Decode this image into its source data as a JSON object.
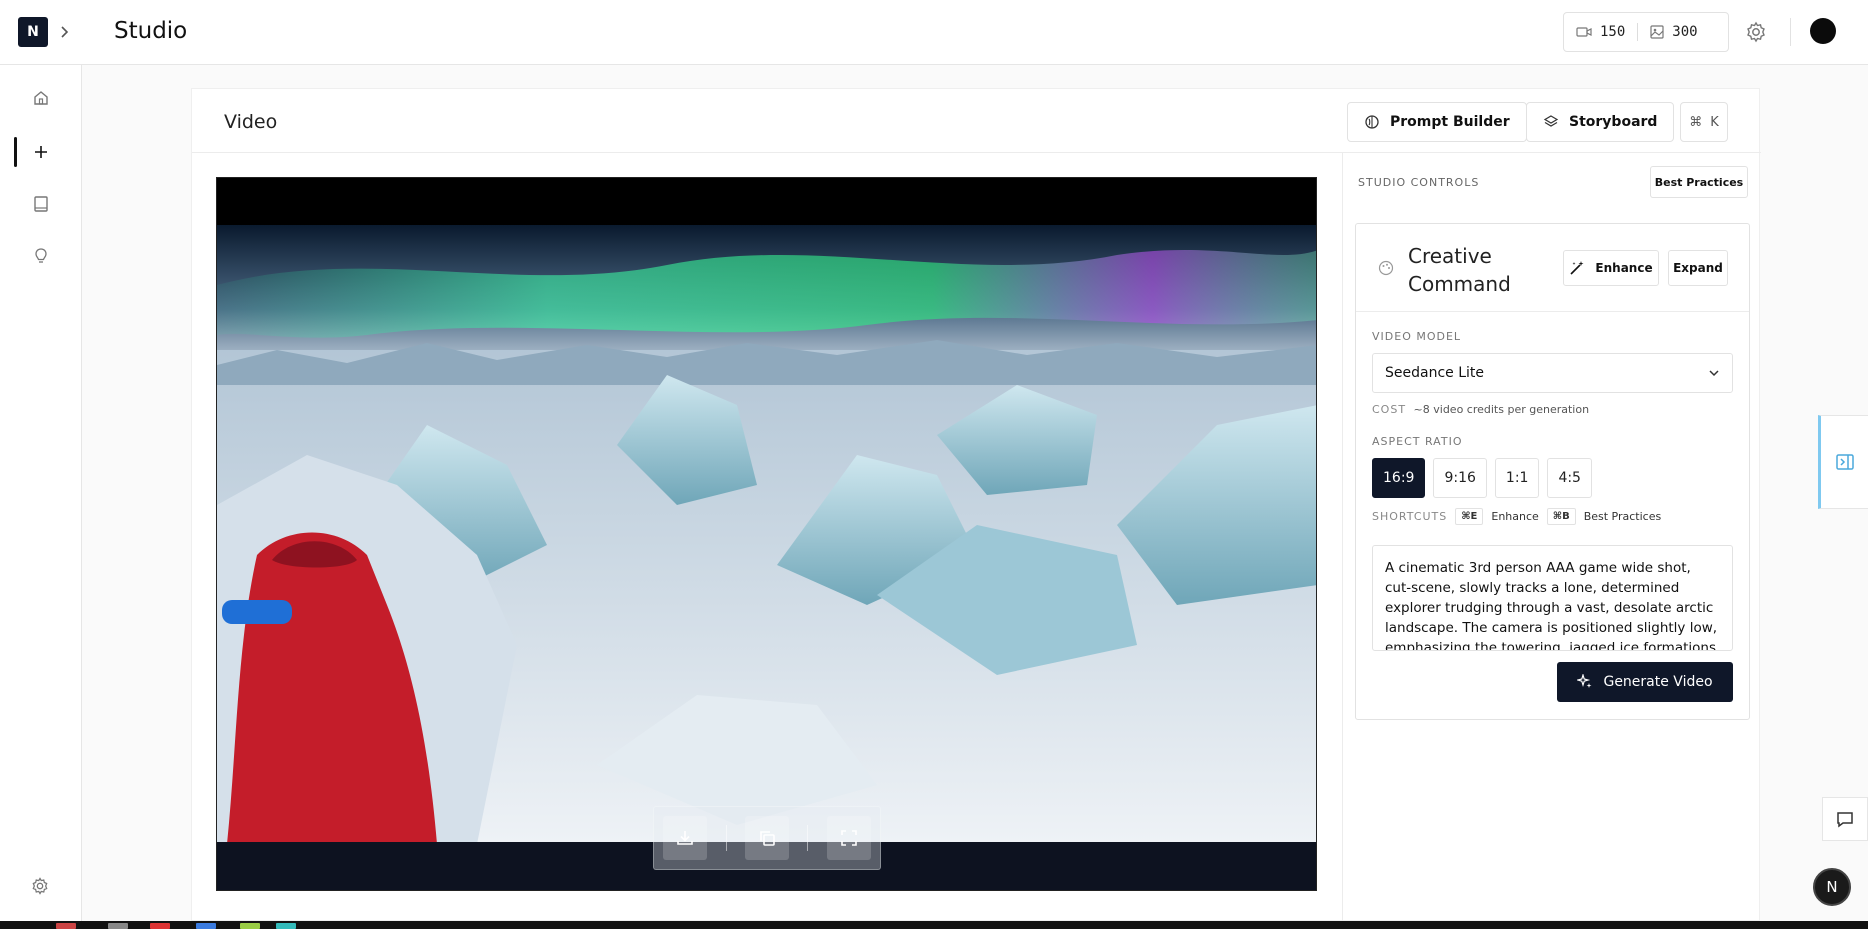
{
  "app": {
    "logo_letter": "N",
    "title": "Studio"
  },
  "credits": {
    "video": "150",
    "image": "300"
  },
  "main": {
    "title": "Video",
    "prompt_builder_label": "Prompt Builder",
    "storyboard_label": "Storyboard",
    "command_key": "⌘",
    "command_letter": "K"
  },
  "controls": {
    "section_label": "STUDIO CONTROLS",
    "best_practices_label": "Best Practices",
    "creative_title": "Creative Command",
    "enhance_label": "Enhance",
    "expand_label": "Expand",
    "video_model_label": "VIDEO MODEL",
    "video_model_value": "Seedance Lite",
    "cost_label": "COST",
    "cost_value": "~8 video credits per generation",
    "aspect_ratio_label": "ASPECT RATIO",
    "ratios": [
      "16:9",
      "9:16",
      "1:1",
      "4:5"
    ],
    "selected_ratio": "16:9",
    "shortcuts_label": "SHORTCUTS",
    "shortcut_enhance_key": "⌘E",
    "shortcut_enhance_label": "Enhance",
    "shortcut_bp_key": "⌘B",
    "shortcut_bp_label": "Best Practices",
    "prompt_text": "A cinematic 3rd person AAA game wide shot, cut-scene, slowly tracks a lone, determined explorer trudging through a vast, desolate arctic landscape. The camera is positioned slightly low, emphasizing the towering, jagged ice formations",
    "generate_label": "Generate Video"
  },
  "fab": {
    "letter": "N"
  },
  "colors": {
    "primary": "#0f1729",
    "accent_edge": "#7fc9f0"
  },
  "icons": [
    "home-icon",
    "plus-icon",
    "book-icon",
    "lightbulb-icon",
    "gear-icon",
    "video-credit-icon",
    "image-credit-icon",
    "brain-icon",
    "layers-icon",
    "palette-icon",
    "magic-wand-icon",
    "chevron-down-icon",
    "sparkle-icon",
    "download-icon",
    "copy-icon",
    "fullscreen-icon",
    "panel-toggle-icon",
    "chat-icon"
  ]
}
